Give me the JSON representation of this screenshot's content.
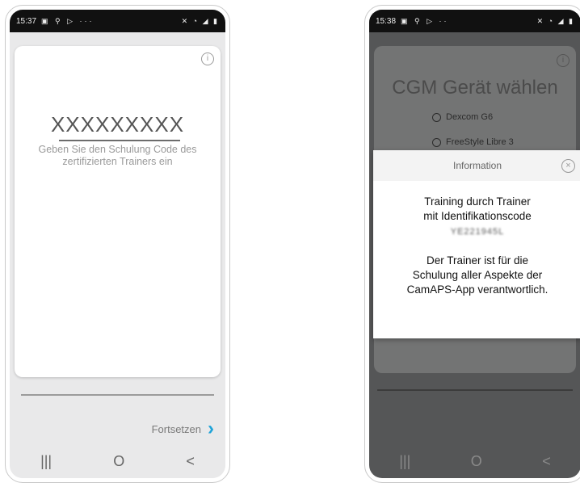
{
  "left_phone": {
    "status": {
      "time": "15:37",
      "icons_left": "▣ ⚲ ▷ ···",
      "icons_right": "✕ ◔ ◢ ▮"
    },
    "code_value": "XXXXXXXXX",
    "code_help": "Geben Sie den Schulung Code des zertifizierten Trainers ein",
    "continue_label": "Fortsetzen",
    "nav": {
      "recent": "|||",
      "home": "O",
      "back": "<"
    }
  },
  "right_phone": {
    "status": {
      "time": "15:38",
      "icons_left": "▣ ⚲ ▷ ··",
      "icons_right": "✕ ◔ ◢ ▮"
    },
    "bg_title": "CGM Gerät wählen",
    "options": [
      "Dexcom G6",
      "FreeStyle Libre 3"
    ],
    "dialog": {
      "title": "Information",
      "line1": "Training durch Trainer",
      "line2": "mit Identifikationscode",
      "code_blurred": "YE221945L",
      "line3": "Der Trainer ist für die",
      "line4": "Schulung aller Aspekte der",
      "line5": "CamAPS-App verantwortlich."
    },
    "nav": {
      "recent": "|||",
      "home": "O",
      "back": "<"
    }
  }
}
